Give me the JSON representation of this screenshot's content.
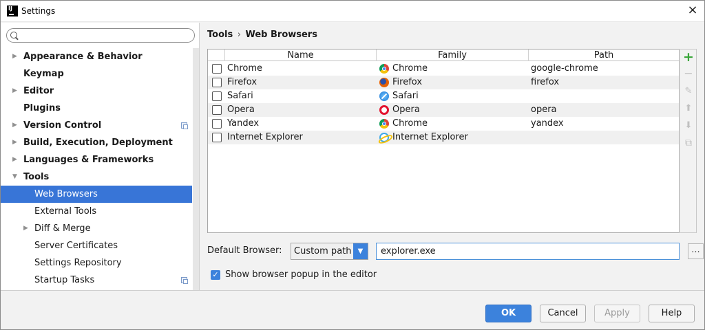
{
  "window": {
    "title": "Settings"
  },
  "search": {
    "placeholder": ""
  },
  "sidebar": {
    "items": [
      {
        "label": "Appearance & Behavior",
        "bold": true,
        "arrow": "right",
        "level": 0
      },
      {
        "label": "Keymap",
        "bold": true,
        "arrow": "",
        "level": 0
      },
      {
        "label": "Editor",
        "bold": true,
        "arrow": "right",
        "level": 0
      },
      {
        "label": "Plugins",
        "bold": true,
        "arrow": "",
        "level": 0
      },
      {
        "label": "Version Control",
        "bold": true,
        "arrow": "right",
        "level": 0,
        "project_icon": true
      },
      {
        "label": "Build, Execution, Deployment",
        "bold": true,
        "arrow": "right",
        "level": 0
      },
      {
        "label": "Languages & Frameworks",
        "bold": true,
        "arrow": "right",
        "level": 0
      },
      {
        "label": "Tools",
        "bold": true,
        "arrow": "down",
        "level": 0
      },
      {
        "label": "Web Browsers",
        "bold": false,
        "arrow": "",
        "level": 1,
        "selected": true
      },
      {
        "label": "External Tools",
        "bold": false,
        "arrow": "",
        "level": 1
      },
      {
        "label": "Diff & Merge",
        "bold": false,
        "arrow": "right",
        "level": 1
      },
      {
        "label": "Server Certificates",
        "bold": false,
        "arrow": "",
        "level": 1
      },
      {
        "label": "Settings Repository",
        "bold": false,
        "arrow": "",
        "level": 1
      },
      {
        "label": "Startup Tasks",
        "bold": false,
        "arrow": "",
        "level": 1,
        "project_icon": true
      }
    ]
  },
  "breadcrumb": {
    "parent": "Tools",
    "separator": "›",
    "current": "Web Browsers"
  },
  "table": {
    "columns": [
      "Name",
      "Family",
      "Path"
    ],
    "rows": [
      {
        "name": "Chrome",
        "family": "Chrome",
        "family_icon": "chrome-icon",
        "path": "google-chrome",
        "checked": false
      },
      {
        "name": "Firefox",
        "family": "Firefox",
        "family_icon": "firefox-icon",
        "path": "firefox",
        "checked": false
      },
      {
        "name": "Safari",
        "family": "Safari",
        "family_icon": "safari-icon",
        "path": "",
        "checked": false
      },
      {
        "name": "Opera",
        "family": "Opera",
        "family_icon": "opera-icon",
        "path": "opera",
        "checked": false
      },
      {
        "name": "Yandex",
        "family": "Chrome",
        "family_icon": "chrome-icon",
        "path": "yandex",
        "checked": false
      },
      {
        "name": "Internet Explorer",
        "family": "Internet Explorer",
        "family_icon": "ie-icon",
        "path": "",
        "checked": false
      }
    ]
  },
  "toolbar": {
    "add": "+",
    "remove": "−",
    "edit": "✎",
    "up": "⬆",
    "down": "⬇",
    "copy": "⧉"
  },
  "default_browser": {
    "label": "Default Browser:",
    "selected": "Custom path",
    "path_value": "explorer.exe",
    "browse": "..."
  },
  "popup_option": {
    "label": "Show browser popup in the editor",
    "checked": true
  },
  "buttons": {
    "ok": "OK",
    "cancel": "Cancel",
    "apply": "Apply",
    "help": "Help"
  },
  "colors": {
    "accent": "#3c82dc",
    "selection": "#3875d7",
    "add_icon": "#3aa63a"
  }
}
